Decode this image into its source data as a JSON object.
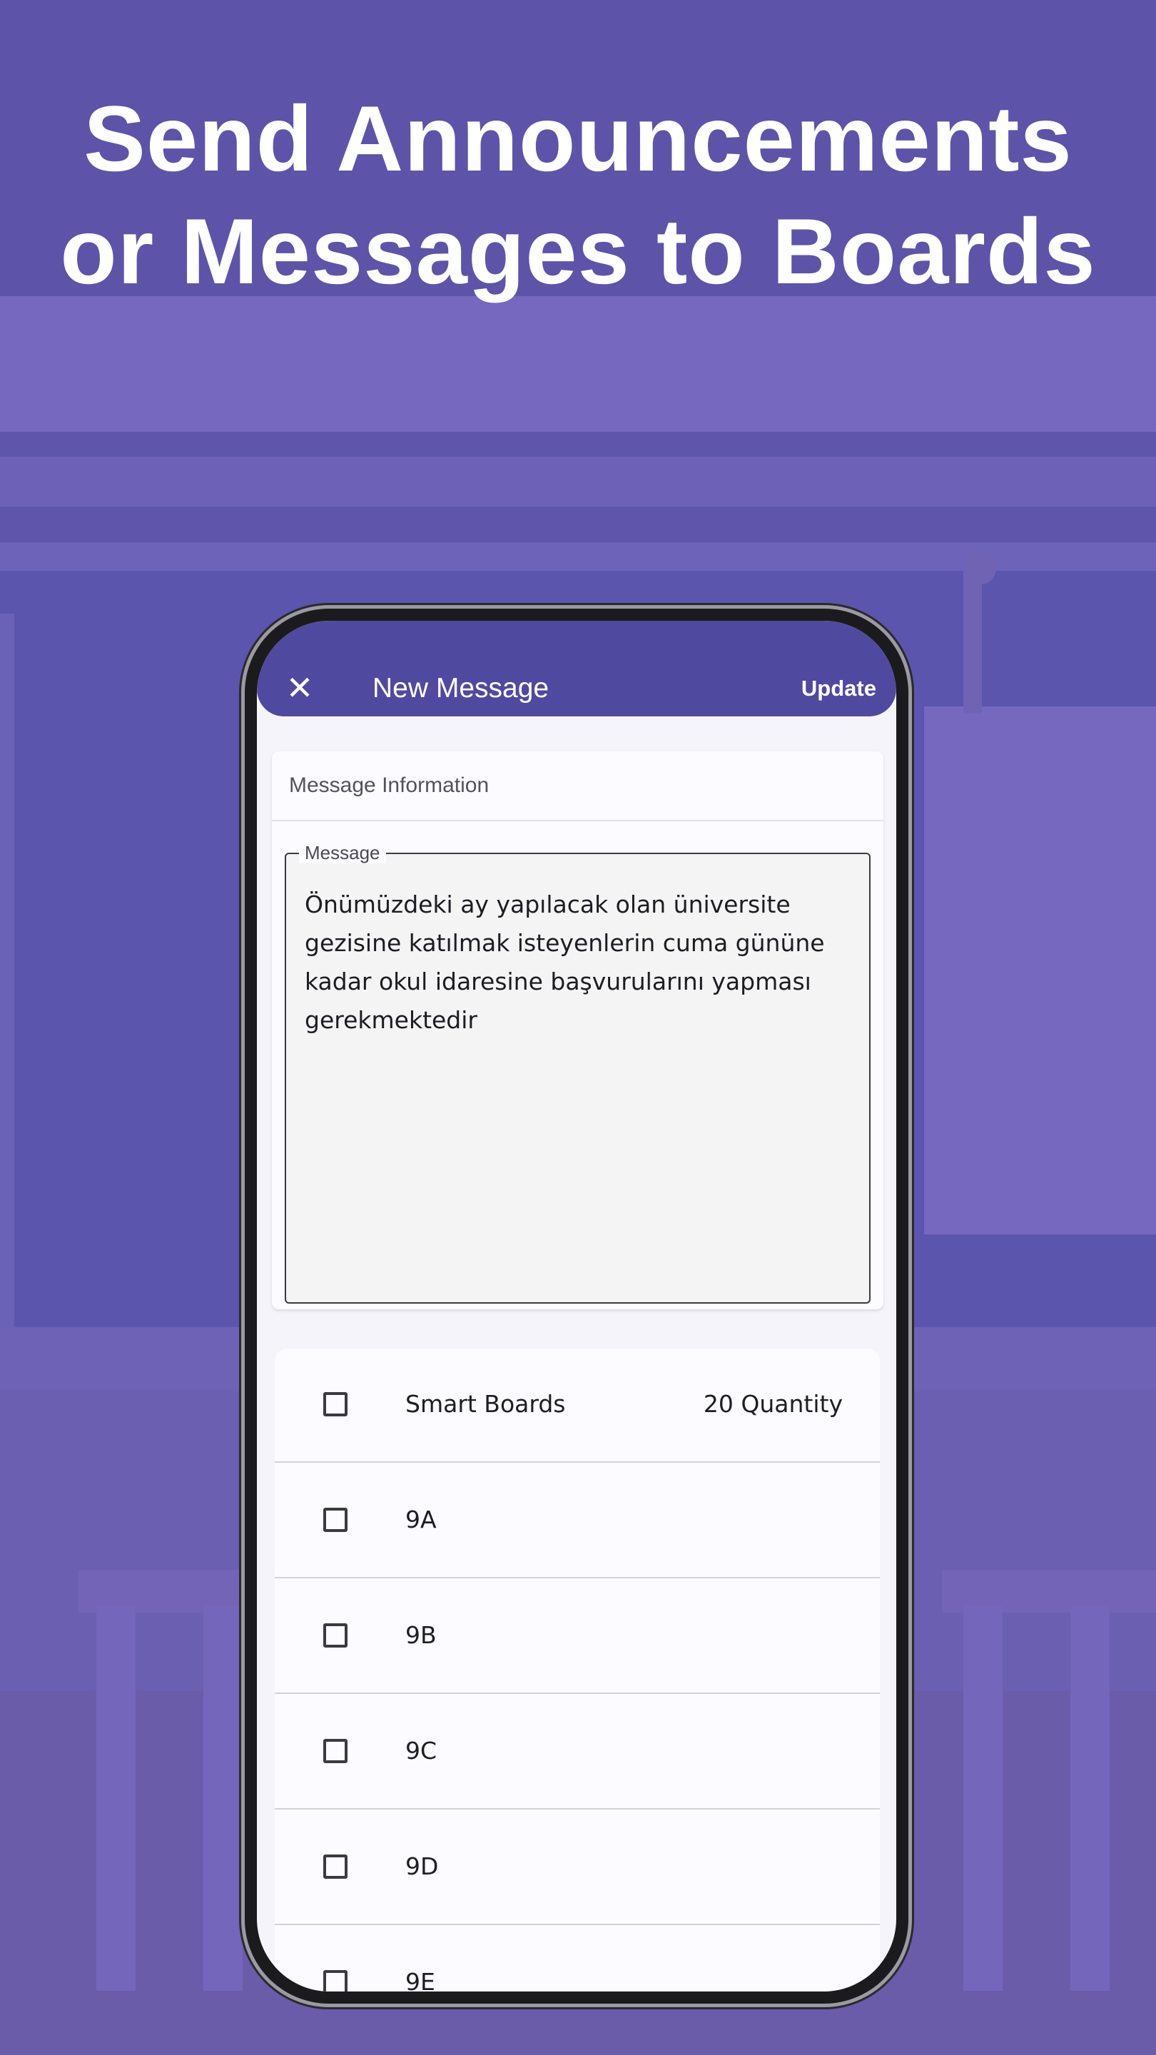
{
  "headline": {
    "line1": "Send Announcements",
    "line2": "or Messages to Boards"
  },
  "colors": {
    "background": "#5f56ac",
    "appbar": "#5049a0",
    "headline_text": "#ffffff"
  },
  "appbar": {
    "close_icon": "close-icon",
    "title": "New Message",
    "action_label": "Update"
  },
  "message_card": {
    "section_title": "Message Information",
    "field_label": "Message",
    "field_value": "Önümüzdeki ay yapılacak olan üniversite gezisine katılmak isteyenlerin cuma gününe kadar okul idaresine başvurularını yapması gerekmektedir"
  },
  "boards": {
    "header": {
      "label": "Smart Boards",
      "quantity": "20 Quantity",
      "checked": false
    },
    "items": [
      {
        "label": "9A",
        "checked": false
      },
      {
        "label": "9B",
        "checked": false
      },
      {
        "label": "9C",
        "checked": false
      },
      {
        "label": "9D",
        "checked": false
      },
      {
        "label": "9E",
        "checked": false
      }
    ]
  }
}
